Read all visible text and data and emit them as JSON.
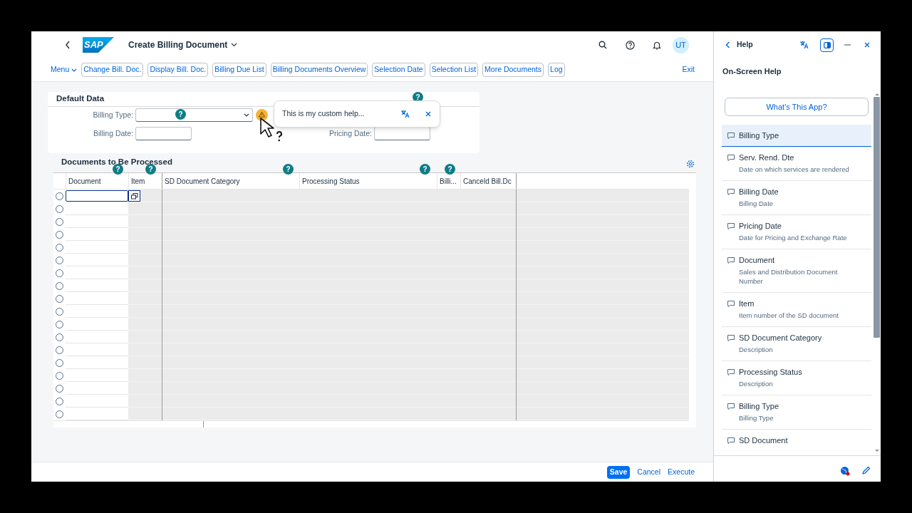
{
  "header": {
    "logo": "SAP",
    "title": "Create Billing Document",
    "avatar": "UT"
  },
  "toolbar": {
    "menu": "Menu",
    "buttons": [
      "Change Bill. Doc.",
      "Display Bill. Doc.",
      "Billing Due List",
      "Billing Documents Overview",
      "Selection Date",
      "Selection List",
      "More Documents",
      "Log"
    ],
    "exit": "Exit"
  },
  "default_data": {
    "title": "Default Data",
    "fields": [
      {
        "label": "Billing Type:",
        "kind": "dropdown"
      },
      {
        "label": "Billing Date:",
        "kind": "date"
      },
      {
        "label": "Pricing Date:",
        "kind": "date"
      }
    ]
  },
  "popover": {
    "text": "This is my custom help..."
  },
  "documents": {
    "title": "Documents to Be Processed",
    "columns": [
      "Document",
      "Item",
      "SD Document Category",
      "Processing Status",
      "Billi...",
      "Canceld Bill.Dc"
    ],
    "rows": [
      {
        "selected": false,
        "focused": true
      },
      {
        "selected": false,
        "focused": false
      },
      {
        "selected": false,
        "focused": false
      },
      {
        "selected": false,
        "focused": false
      },
      {
        "selected": false,
        "focused": false
      },
      {
        "selected": false,
        "focused": false
      },
      {
        "selected": false,
        "focused": false
      },
      {
        "selected": false,
        "focused": false
      },
      {
        "selected": false,
        "focused": false
      },
      {
        "selected": false,
        "focused": false
      },
      {
        "selected": false,
        "focused": false
      },
      {
        "selected": false,
        "focused": false
      },
      {
        "selected": false,
        "focused": false
      },
      {
        "selected": false,
        "focused": false
      },
      {
        "selected": false,
        "focused": false
      },
      {
        "selected": false,
        "focused": false
      },
      {
        "selected": false,
        "focused": false
      },
      {
        "selected": false,
        "focused": false
      }
    ]
  },
  "help_markers": [
    {
      "symbol": "?"
    },
    {
      "symbol": "?"
    },
    {
      "symbol": "?"
    },
    {
      "symbol": "?"
    },
    {
      "symbol": "?"
    },
    {
      "symbol": "?"
    },
    {
      "symbol": "?"
    }
  ],
  "footer": {
    "buttons": [
      {
        "label": "Save",
        "kind": "primary"
      },
      {
        "label": "Cancel",
        "kind": "link"
      },
      {
        "label": "Execute",
        "kind": "link"
      }
    ]
  },
  "help_panel": {
    "title": "Help",
    "heading": "On-Screen Help",
    "app_button": "What's This App?",
    "items": [
      {
        "title": "Billing Type",
        "selected": true
      },
      {
        "title": "Serv. Rend. Dte",
        "description": "Date on which services are rendered",
        "selected": false
      },
      {
        "title": "Billing Date",
        "description": "Billing Date",
        "selected": false
      },
      {
        "title": "Pricing Date",
        "description": "Date for Pricing and Exchange Rate",
        "selected": false
      },
      {
        "title": "Document",
        "description": "Sales and Distribution Document Number",
        "selected": false
      },
      {
        "title": "Item",
        "description": "Item number of the SD document",
        "selected": false
      },
      {
        "title": "SD Document Category",
        "description": "Description",
        "selected": false
      },
      {
        "title": "Processing Status",
        "description": "Description",
        "selected": false
      },
      {
        "title": "Billing Type",
        "description": "Billing Type",
        "selected": false
      },
      {
        "title": "SD Document",
        "selected": false
      }
    ]
  }
}
